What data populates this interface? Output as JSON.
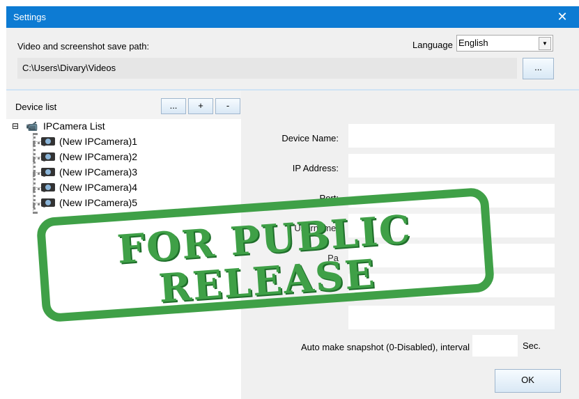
{
  "window": {
    "title": "Settings",
    "close_glyph": "✕"
  },
  "save_path": {
    "label": "Video and screenshot save path:",
    "value": "C:\\Users\\Divary\\Videos",
    "browse_label": "..."
  },
  "language": {
    "label": "Language",
    "selected": "English",
    "arrow": "▼"
  },
  "device_list": {
    "label": "Device list",
    "buttons": {
      "more": "...",
      "add": "+",
      "remove": "-"
    },
    "root": {
      "expander": "⊟",
      "label": "IPCamera List"
    },
    "items": [
      "(New IPCamera)1",
      "(New IPCamera)2",
      "(New IPCamera)3",
      "(New IPCamera)4",
      "(New IPCamera)5"
    ]
  },
  "form": {
    "device_name": "Device Name:",
    "ip_address": "IP Address:",
    "port": "Port:",
    "username": "Username:",
    "password": "Pa",
    "field6": "",
    "field7": "",
    "snapshot": "Auto make snapshot (0-Disabled), interval",
    "sec": "Sec.",
    "ok": "OK"
  },
  "stamp": {
    "line1": "FOR PUBLIC",
    "line2": "RELEASE"
  },
  "colors": {
    "titlebar": "#0d7bd3",
    "stamp": "#3fa047"
  }
}
